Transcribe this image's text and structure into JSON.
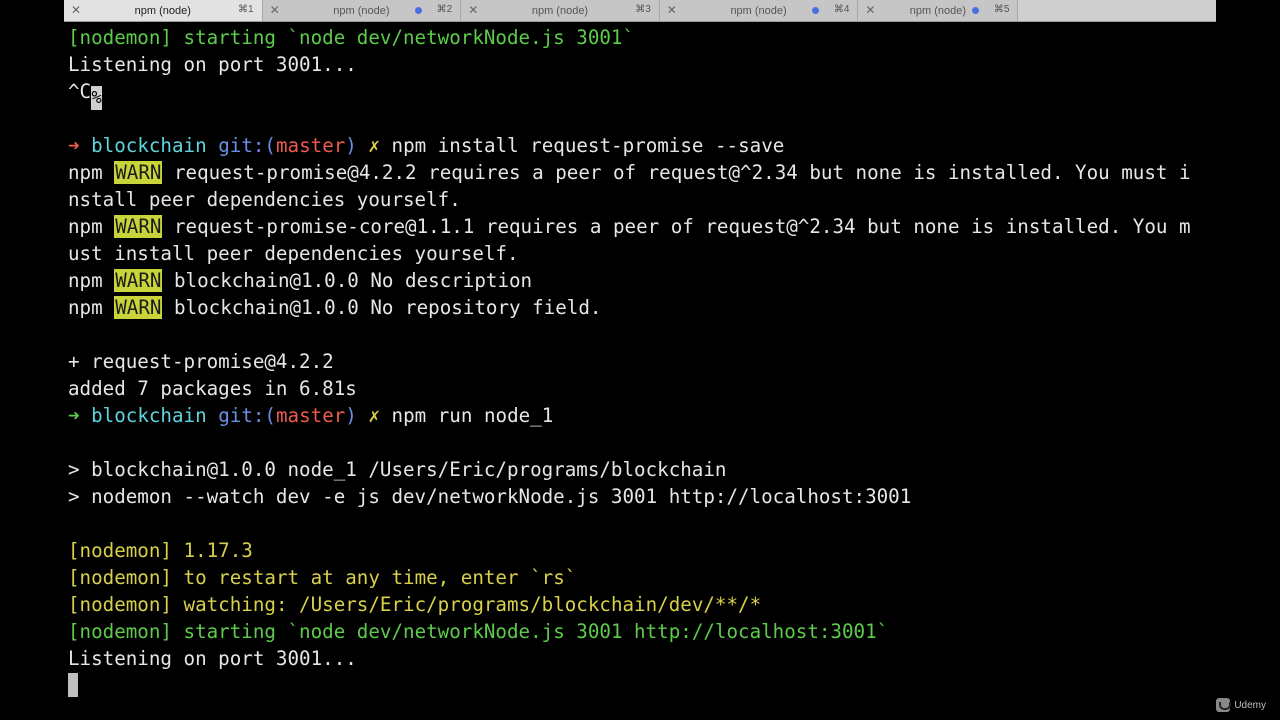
{
  "tabs": [
    {
      "title": "npm (node)",
      "key": "⌘1",
      "active": true
    },
    {
      "title": "npm (node)",
      "key": "⌘2",
      "active": false
    },
    {
      "title": "npm (node)",
      "key": "⌘3",
      "active": false
    },
    {
      "title": "npm (node)",
      "key": "⌘4",
      "active": false
    },
    {
      "title": "npm (node)",
      "key": "⌘5",
      "active": false
    }
  ],
  "terminal": {
    "line1": "[nodemon] starting `node dev/networkNode.js 3001`",
    "line2": "Listening on port 3001...",
    "line3": "^C",
    "line3_cursor": "%",
    "prompt_arrow": "➜",
    "prompt_dir": "blockchain",
    "prompt_git": "git:(",
    "prompt_branch": "master",
    "prompt_git_close": ")",
    "prompt_dirty": "✗",
    "cmd1": "npm install request-promise --save",
    "npm": "npm",
    "warn": "WARN",
    "warn1a": "request-promise@4.2.2 requires a peer of request@^2.34 but none is installed. You must i",
    "warn1b": "nstall peer dependencies yourself.",
    "warn2a": "request-promise-core@1.1.1 requires a peer of request@^2.34 but none is installed. You m",
    "warn2b": "ust install peer dependencies yourself.",
    "warn3": "blockchain@1.0.0 No description",
    "warn4": "blockchain@1.0.0 No repository field.",
    "added_pkg": "+ request-promise@4.2.2",
    "added_summary": "added 7 packages in 6.81s",
    "cmd2": "npm run node_1",
    "run1": "> blockchain@1.0.0 node_1 /Users/Eric/programs/blockchain",
    "run2": "> nodemon --watch dev -e js dev/networkNode.js 3001 http://localhost:3001",
    "nm_tag": "[nodemon]",
    "nm1": "1.17.3",
    "nm2": "to restart at any time, enter `rs`",
    "nm3": "watching: /Users/Eric/programs/blockchain/dev/**/*",
    "nm4": "starting `node dev/networkNode.js 3001 http://localhost:3001`",
    "listen": "Listening on port 3001..."
  },
  "watermark": {
    "label": "Udemy"
  }
}
